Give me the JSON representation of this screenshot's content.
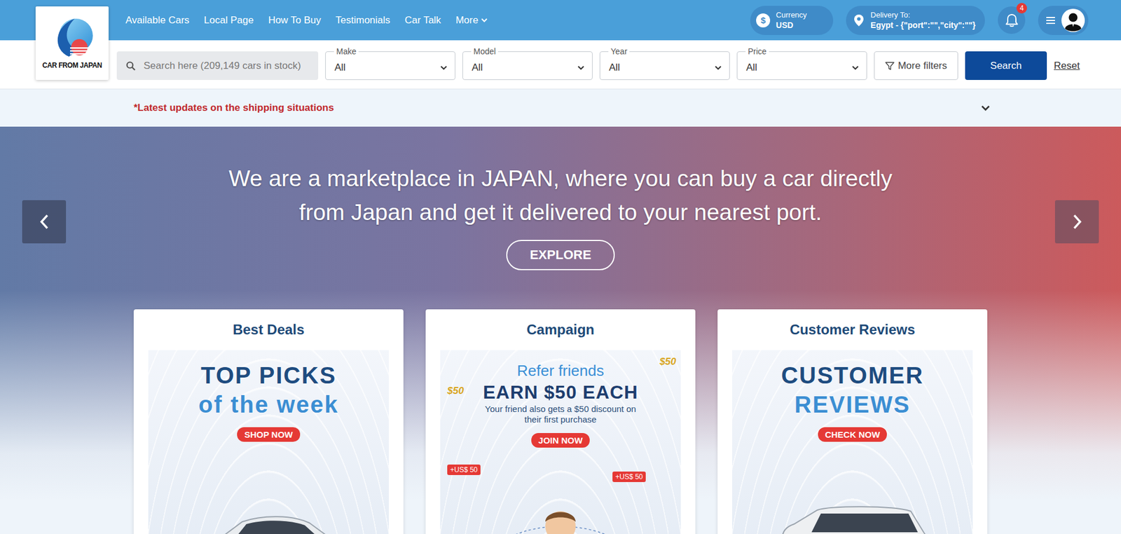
{
  "logo": {
    "text": "CAR FROM JAPAN"
  },
  "nav": {
    "links": [
      "Available Cars",
      "Local Page",
      "How To Buy",
      "Testimonials",
      "Car Talk"
    ],
    "more": "More"
  },
  "currency": {
    "icon": "$",
    "label": "Currency",
    "value": "USD"
  },
  "delivery": {
    "label": "Delivery To:",
    "value": "Egypt - {\"port\":\"\",\"city\":\"\"}"
  },
  "notifications": {
    "count": "4"
  },
  "search": {
    "placeholder": "Search here (209,149 cars in stock)",
    "filters": [
      {
        "label": "Make",
        "value": "All"
      },
      {
        "label": "Model",
        "value": "All"
      },
      {
        "label": "Year",
        "value": "All"
      },
      {
        "label": "Price",
        "value": "All"
      }
    ],
    "more_filters": "More filters",
    "submit": "Search",
    "reset": "Reset"
  },
  "notice": {
    "text": "*Latest updates on the shipping situations",
    "expanded": false
  },
  "hero": {
    "headline": "We are a marketplace in JAPAN, where you can buy a car directly from Japan and get it delivered to your nearest port.",
    "button": "EXPLORE"
  },
  "cards": [
    {
      "title": "Best Deals",
      "banner": {
        "kind": "car",
        "headline": "TOP PICKS",
        "subline": "of the week",
        "button": "SHOP NOW"
      }
    },
    {
      "title": "Campaign",
      "banner": {
        "kind": "referral",
        "headline": "Refer friends",
        "subline": "EARN $50 EACH",
        "note": "Your friend also gets a $50 discount on their first purchase",
        "button": "JOIN NOW",
        "tags": [
          "+US$ 50",
          "+US$ 50"
        ],
        "coins": [
          "$50",
          "$50"
        ]
      }
    },
    {
      "title": "Customer Reviews",
      "banner": {
        "kind": "van",
        "headline": "CUSTOMER",
        "subline": "REVIEWS",
        "button": "CHECK NOW"
      }
    }
  ]
}
